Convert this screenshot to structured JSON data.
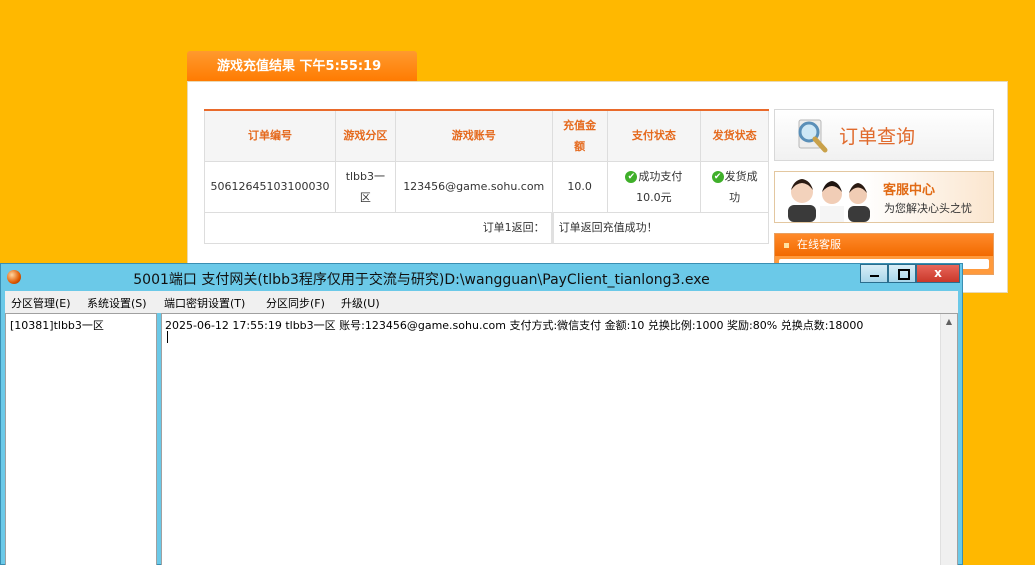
{
  "web": {
    "tab_title": "游戏充值结果 下午5:55:19",
    "table": {
      "headers": [
        "订单编号",
        "游戏分区",
        "游戏账号",
        "充值金额",
        "支付状态",
        "发货状态"
      ],
      "row": {
        "order_id": "50612645103100030",
        "zone": "tlbb3一区",
        "account": "123456@game.sohu.com",
        "amount": "10.0",
        "pay_status": "成功支付10.0元",
        "ship_status": "发货成功"
      },
      "return_label": "订单1返回：",
      "return_value": "订单返回充值成功！"
    },
    "query_label": "订单查询",
    "service_title": "客服中心",
    "service_sub": "为您解决心头之忧",
    "online_service": "在线客服"
  },
  "window": {
    "title": "5001端口 支付网关(tlbb3程序仅用于交流与研究)D:\\wangguan\\PayClient_tianlong3.exe",
    "close_label": "x",
    "menu": [
      "分区管理(E)",
      "系统设置(S)",
      "端口密钥设置(T)",
      "分区同步(F)",
      "升级(U)"
    ],
    "zones": [
      "[10381]tlbb3一区"
    ],
    "log_line": "2025-06-12 17:55:19  tlbb3一区  账号:123456@game.sohu.com  支付方式:微信支付  金额:10  兑换比例:1000  奖励:80%  兑换点数:18000"
  }
}
